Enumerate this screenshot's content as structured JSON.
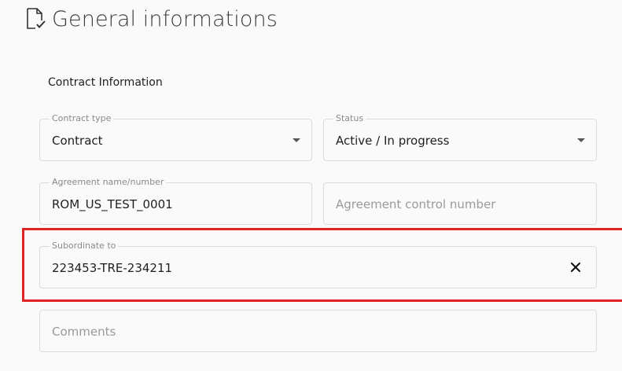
{
  "header": {
    "title": "General informations",
    "icon": "document-check-icon"
  },
  "section": {
    "title": "Contract Information"
  },
  "fields": {
    "contract_type": {
      "label": "Contract type",
      "value": "Contract"
    },
    "status": {
      "label": "Status",
      "value": "Active / In progress"
    },
    "agreement_name": {
      "label": "Agreement name/number",
      "value": "ROM_US_TEST_0001"
    },
    "agreement_control_number": {
      "placeholder": "Agreement control number"
    },
    "subordinate_to": {
      "label": "Subordinate to",
      "value": "223453-TRE-234211",
      "clear_icon": "close-icon"
    },
    "comments": {
      "placeholder": "Comments"
    }
  },
  "colors": {
    "highlight": "#e02424",
    "border": "#dcdcdc",
    "label": "#8a8a8a",
    "placeholder": "#9a9a9a"
  }
}
